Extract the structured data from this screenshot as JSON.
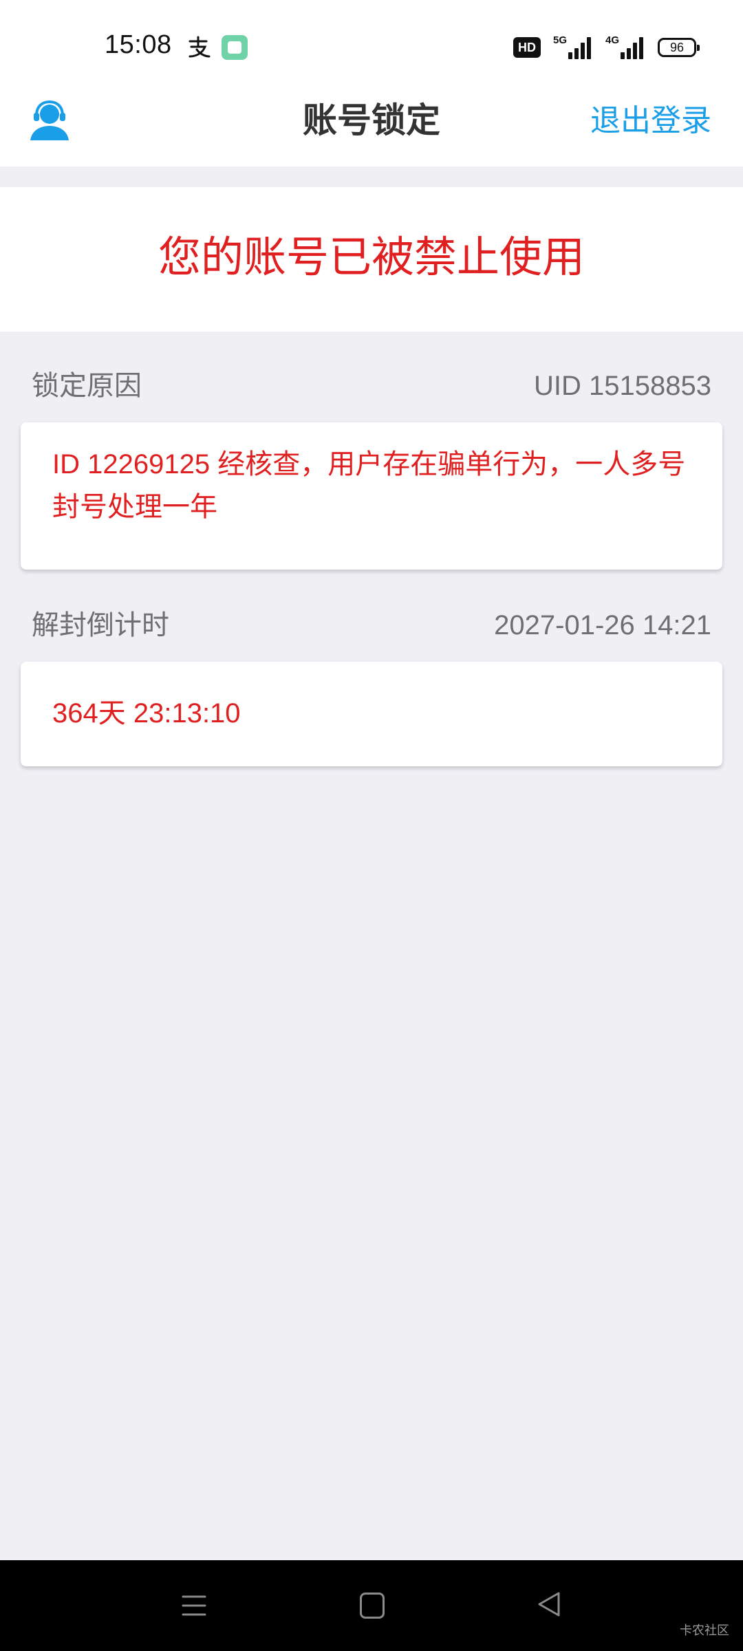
{
  "status_bar": {
    "time": "15:08",
    "notifications": [
      "alipay-icon",
      "app-icon"
    ],
    "hd_label": "HD",
    "network_1": "5G",
    "network_2": "4G",
    "battery": "96"
  },
  "header": {
    "support_icon": "customer-service-icon",
    "title": "账号锁定",
    "logout_label": "退出登录"
  },
  "banner": {
    "text": "您的账号已被禁止使用"
  },
  "lock_reason": {
    "label": "锁定原因",
    "uid": "UID 15158853",
    "text": "ID 12269125 经核查，用户存在骗单行为，一人多号封号处理一年"
  },
  "unlock_countdown": {
    "label": "解封倒计时",
    "datetime": "2027-01-26 14:21",
    "remaining": "364天 23:13:10"
  },
  "nav_bar": {
    "icons": [
      "menu-icon",
      "home-icon",
      "back-icon"
    ]
  },
  "watermark": "卡农社区",
  "colors": {
    "accent_blue": "#1a9ee8",
    "alert_red": "#e02020",
    "background": "#efeff4",
    "label_gray": "#6f6f6f"
  }
}
